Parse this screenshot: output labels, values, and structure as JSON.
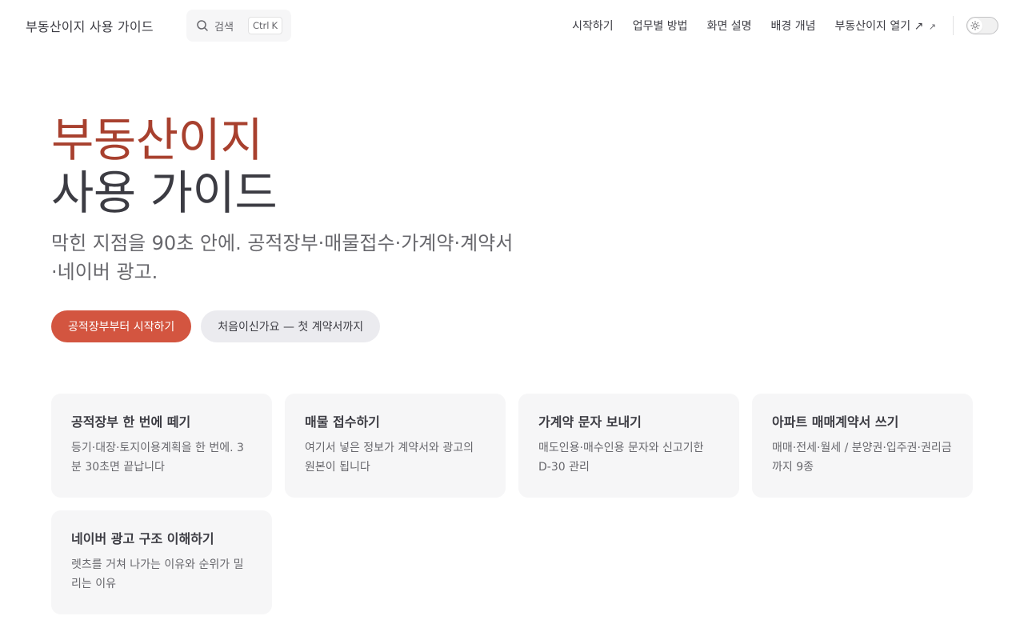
{
  "site": {
    "title": "부동산이지 사용 가이드"
  },
  "search": {
    "placeholder": "검색",
    "shortcut_mod": "Ctrl",
    "shortcut_key": "K"
  },
  "nav": {
    "links": [
      {
        "label": "시작하기"
      },
      {
        "label": "업무별 방법"
      },
      {
        "label": "화면 설명"
      },
      {
        "label": "배경 개념"
      },
      {
        "label": "부동산이지 열기 ↗",
        "external_icon": "↗"
      }
    ]
  },
  "theme_toggle": {
    "icon": "sun-icon"
  },
  "hero": {
    "name": "부동산이지",
    "text": "사용 가이드",
    "tagline": "막힌 지점을 90초 안에. 공적장부·매물접수·가계약·계약서·네이버 광고."
  },
  "actions": {
    "primary": "공적장부부터 시작하기",
    "secondary": "처음이신가요 — 첫 계약서까지"
  },
  "features": [
    {
      "title": "공적장부 한 번에 떼기",
      "details": "등기·대장·토지이용계획을 한 번에. 3분 30초면 끝납니다"
    },
    {
      "title": "매물 접수하기",
      "details": "여기서 넣은 정보가 계약서와 광고의 원본이 됩니다"
    },
    {
      "title": "가계약 문자 보내기",
      "details": "매도인용·매수인용 문자와 신고기한 D-30 관리"
    },
    {
      "title": "아파트 매매계약서 쓰기",
      "details": "매매·전세·월세 / 분양권·입주권·권리금까지 9종"
    },
    {
      "title": "네이버 광고 구조 이해하기",
      "details": "렛츠를 거쳐 나가는 이유와 순위가 밀리는 이유"
    }
  ],
  "colors": {
    "brand": "#a8402e",
    "brand_button": "#d35540",
    "text": "#3c3c43",
    "muted": "#67676c",
    "card_bg": "#f6f6f7"
  }
}
